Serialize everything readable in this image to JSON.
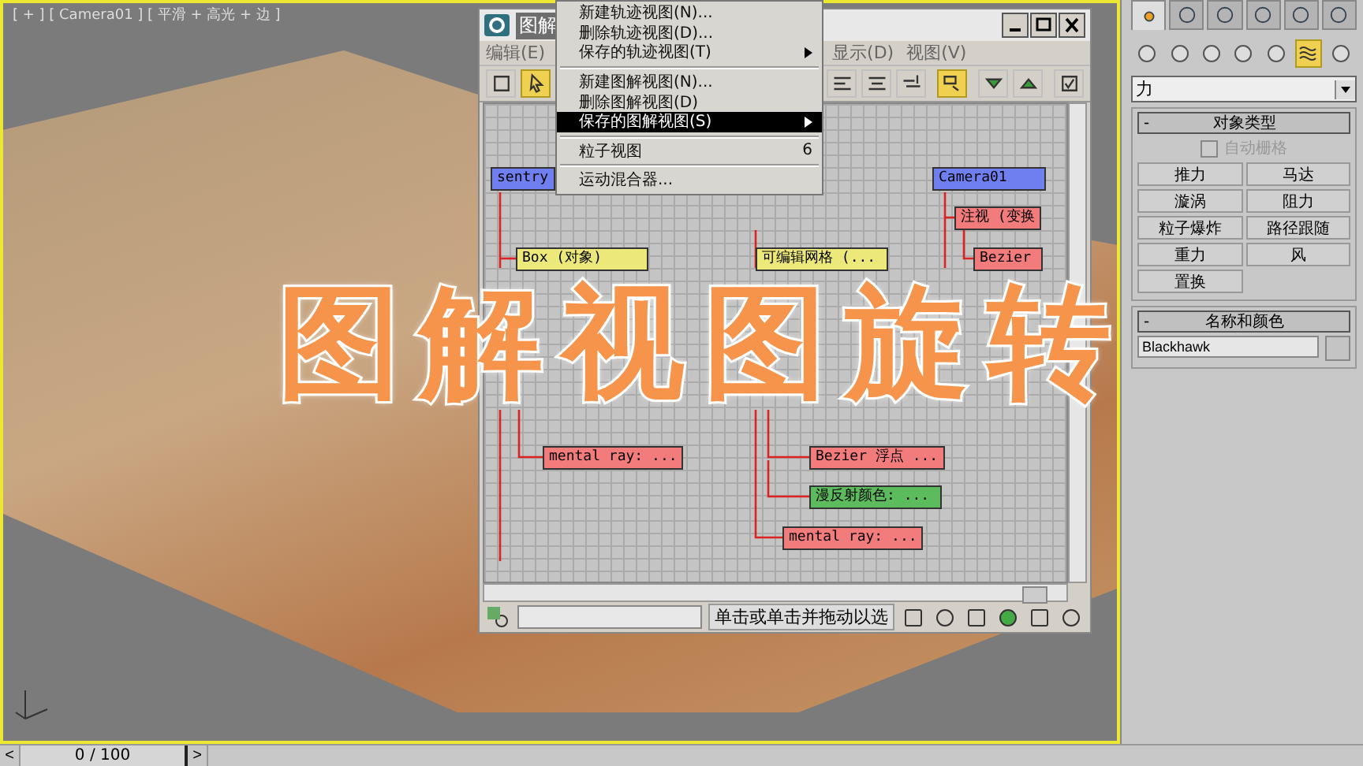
{
  "viewport": {
    "label": "[ + ] [ Camera01 ] [ 平滑 + 高光 + 边 ]",
    "active": true
  },
  "schematic_window": {
    "title": "图解",
    "menus": [
      {
        "label": "编辑(E)"
      },
      {
        "label": "显示(D)"
      },
      {
        "label": "视图(V)"
      }
    ],
    "toolbar": [
      {
        "selected": false
      },
      {
        "selected": true
      },
      {
        "selected": false
      },
      {
        "selected": false
      },
      {
        "selected": false
      },
      {
        "selected": true
      },
      {
        "selected": false
      },
      {
        "selected": false
      },
      {
        "selected": false
      }
    ],
    "nodes": [
      {
        "label": "sentry",
        "color": "#6f7ff0"
      },
      {
        "label": "Camera01",
        "color": "#6f7ff0"
      },
      {
        "label": "注视 (变换",
        "color": "#f27c7c"
      },
      {
        "label": "Box (对象)",
        "color": "#ece87a"
      },
      {
        "label": "可编辑网格 (...",
        "color": "#ece87a"
      },
      {
        "label": "Bezier",
        "color": "#f27c7c"
      },
      {
        "label": "mental ray: ...",
        "color": "#f27c7c"
      },
      {
        "label": "Bezier 浮点 ...",
        "color": "#f27c7c"
      },
      {
        "label": "漫反射颜色: ...",
        "color": "#5cbb5c"
      },
      {
        "label": "mental ray: ...",
        "color": "#f27c7c"
      }
    ],
    "status_text": "单击或单击并拖动以选"
  },
  "dropdown_menu": {
    "items": [
      {
        "kind": "item",
        "label": "新建轨迹视图(N)...",
        "submenu": false,
        "selected": false
      },
      {
        "kind": "item",
        "label": "删除轨迹视图(D)...",
        "submenu": false,
        "selected": false
      },
      {
        "kind": "item",
        "label": "保存的轨迹视图(T)",
        "submenu": true,
        "selected": false
      },
      {
        "kind": "separator"
      },
      {
        "kind": "item",
        "label": "新建图解视图(N)...",
        "submenu": false,
        "selected": false
      },
      {
        "kind": "item",
        "label": "删除图解视图(D)",
        "submenu": false,
        "selected": false
      },
      {
        "kind": "item",
        "label": "保存的图解视图(S)",
        "submenu": true,
        "selected": true
      },
      {
        "kind": "separator"
      },
      {
        "kind": "item",
        "label": "粒子视图",
        "shortcut": "6",
        "submenu": false,
        "selected": false
      },
      {
        "kind": "separator"
      },
      {
        "kind": "item",
        "label": "运动混合器...",
        "submenu": false,
        "selected": false
      }
    ]
  },
  "command_panel": {
    "tabs": [
      {
        "selected": true
      },
      {
        "selected": false
      },
      {
        "selected": false
      },
      {
        "selected": false
      },
      {
        "selected": false
      },
      {
        "selected": false
      }
    ],
    "categories": [
      {
        "selected": false
      },
      {
        "selected": false
      },
      {
        "selected": false
      },
      {
        "selected": false
      },
      {
        "selected": false
      },
      {
        "selected": true
      },
      {
        "selected": false
      }
    ],
    "dropdown": "力",
    "object_type": {
      "collapse": "-",
      "title": "对象类型",
      "checkbox": {
        "label": "自动栅格",
        "checked": false,
        "disabled": true
      },
      "buttons": [
        "推力",
        "马达",
        "漩涡",
        "阻力",
        "粒子爆炸",
        "路径跟随",
        "重力",
        "风",
        "置换"
      ]
    },
    "name_color": {
      "collapse": "-",
      "title": "名称和颜色",
      "value": "Blackhawk"
    }
  },
  "timeline": {
    "prev": "<",
    "frame": "0 / 100",
    "next": ">"
  },
  "overlay_title": "图解视图旋转"
}
